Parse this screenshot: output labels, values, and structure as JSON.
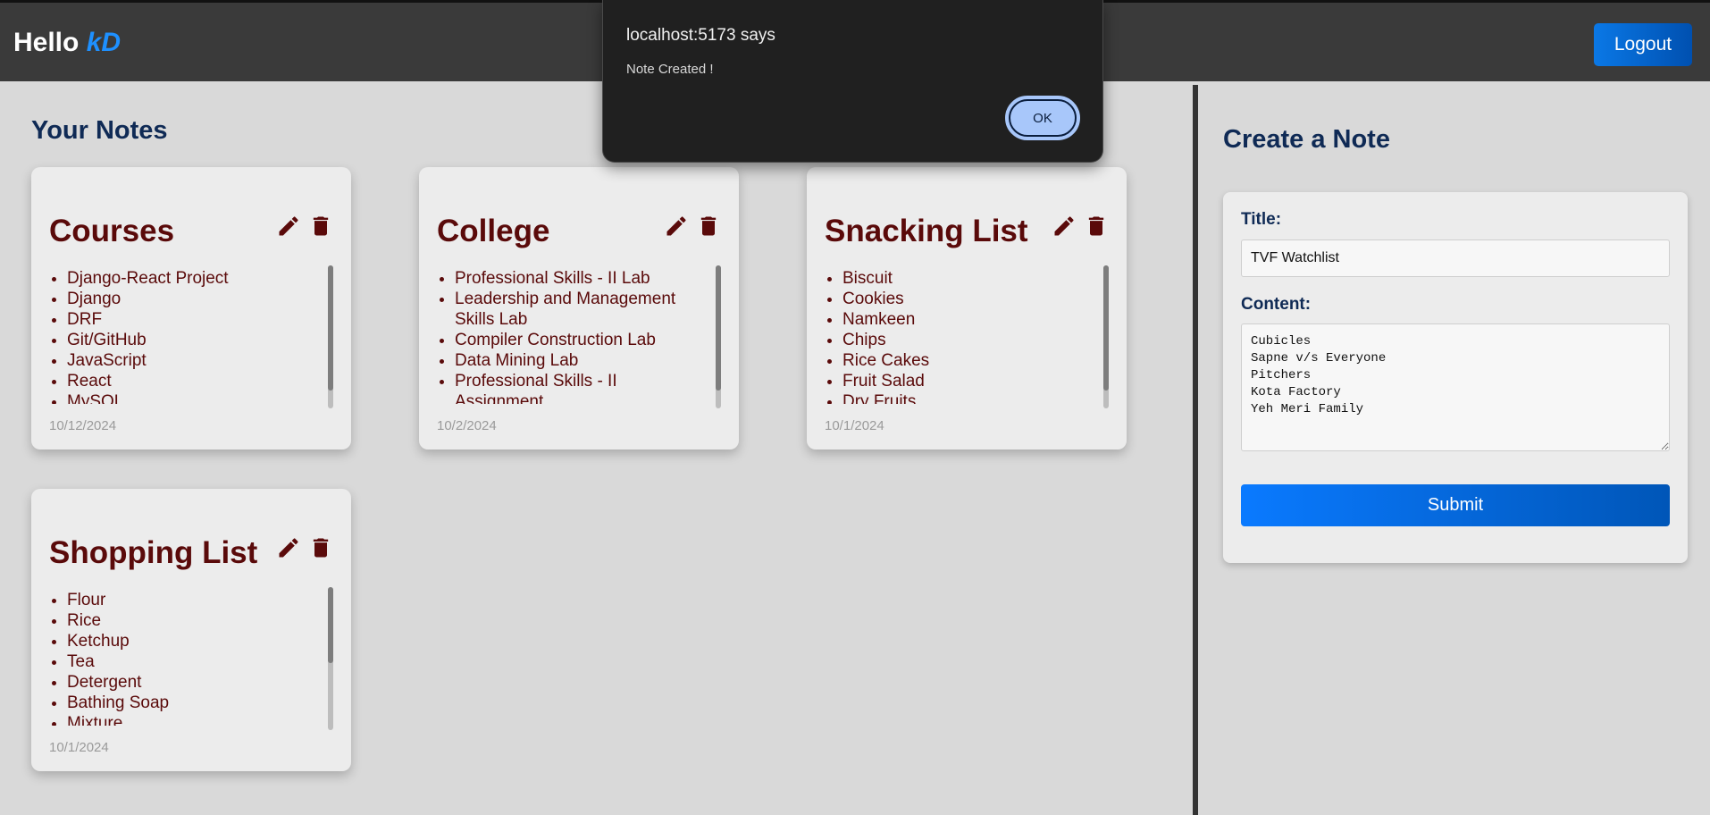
{
  "header": {
    "greeting": "Hello",
    "username": "kD",
    "logout_label": "Logout"
  },
  "notes_section": {
    "heading": "Your Notes",
    "notes": [
      {
        "title": "Courses",
        "items": [
          "Django-React Project",
          "Django",
          "DRF",
          "Git/GitHub",
          "JavaScript",
          "React",
          "MySQL"
        ],
        "date": "10/12/2024"
      },
      {
        "title": "College",
        "items": [
          "Professional Skills - II Lab",
          "Leadership and Management Skills Lab",
          "Compiler Construction Lab",
          "Data Mining Lab",
          "Professional Skills - II Assignment"
        ],
        "date": "10/2/2024"
      },
      {
        "title": "Snacking List",
        "items": [
          "Biscuit",
          "Cookies",
          "Namkeen",
          "Chips",
          "Rice Cakes",
          "Fruit Salad",
          "Dry Fruits"
        ],
        "date": "10/1/2024"
      },
      {
        "title": "Shopping List",
        "items": [
          "Flour",
          "Rice",
          "Ketchup",
          "Tea",
          "Detergent",
          "Bathing Soap",
          "Mixture"
        ],
        "date": "10/1/2024"
      }
    ],
    "icons": {
      "edit": "pencil-icon",
      "delete": "trash-icon"
    }
  },
  "create_form": {
    "heading": "Create a Note",
    "title_label": "Title:",
    "title_value": "TVF Watchlist",
    "content_label": "Content:",
    "content_value": "Cubicles\nSapne v/s Everyone\nPitchers\nKota Factory\nYeh Meri Family",
    "submit_label": "Submit"
  },
  "alert": {
    "title": "localhost:5173 says",
    "message": "Note Created !",
    "ok_label": "OK"
  },
  "colors": {
    "accent": "#0a7aff",
    "note_text": "#5a0a0a",
    "heading": "#0f2a55",
    "topbar": "#3a3a3a",
    "username": "#1e90ff"
  }
}
